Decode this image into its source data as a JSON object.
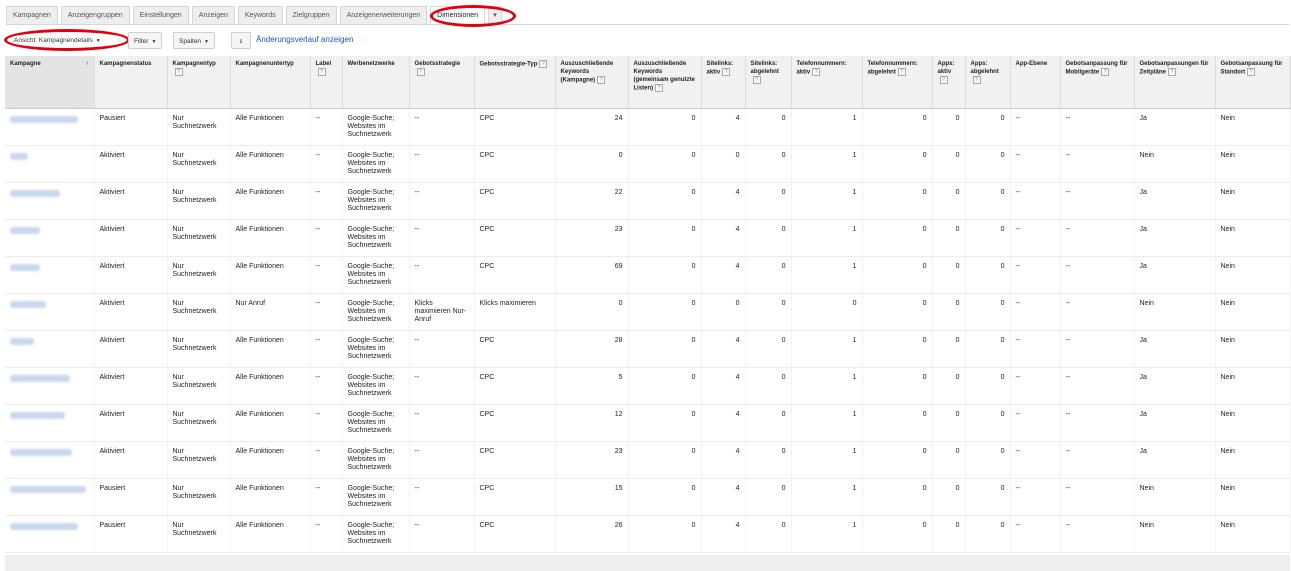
{
  "tabs": [
    {
      "label": "Kampagnen",
      "active": false
    },
    {
      "label": "Anzeigengruppen",
      "active": false
    },
    {
      "label": "Einstellungen",
      "active": false
    },
    {
      "label": "Anzeigen",
      "active": false
    },
    {
      "label": "Keywords",
      "active": false
    },
    {
      "label": "Zielgruppen",
      "active": false
    },
    {
      "label": "Anzeigenerweiterungen",
      "active": false
    },
    {
      "label": "Dimensionen",
      "active": true
    }
  ],
  "tab_more_glyph": "▾",
  "toolbar": {
    "view_label": "Ansicht: Kampagnendetails",
    "filter_label": "Filter",
    "columns_label": "Spalten",
    "download_icon": "download-icon",
    "history_link": "Änderungsverlauf anzeigen"
  },
  "accent_colors": {
    "link": "#1a55c0",
    "highlight_ring": "#e0000f",
    "header_bg": "#f1f1f1"
  },
  "table": {
    "headers": [
      {
        "label": "Kampagne",
        "help": false
      },
      {
        "label": "Kampagnenstatus",
        "help": false
      },
      {
        "label": "Kampagnentyp",
        "help": true
      },
      {
        "label": "Kampagnenuntertyp",
        "help": false
      },
      {
        "label": "Label",
        "help": true
      },
      {
        "label": "Werbenetzwerke",
        "help": false
      },
      {
        "label": "Gebotsstrategie",
        "help": true
      },
      {
        "label": "Gebotsstrategie-Typ",
        "help": true
      },
      {
        "label": "Auszuschließende Keywords (Kampagne)",
        "help": true
      },
      {
        "label": "Auszuschließende Keywords (gemeinsam genutzte Listen)",
        "help": true
      },
      {
        "label": "Sitelinks: aktiv",
        "help": true
      },
      {
        "label": "Sitelinks: abgelehnt",
        "help": true
      },
      {
        "label": "Telefonnummern: aktiv",
        "help": true
      },
      {
        "label": "Telefonnummern: abgelehnt",
        "help": true
      },
      {
        "label": "Apps: aktiv",
        "help": true
      },
      {
        "label": "Apps: abgelehnt",
        "help": true
      },
      {
        "label": "App-Ebene",
        "help": false
      },
      {
        "label": "Gebotsanpassung für Mobilgeräte",
        "help": true
      },
      {
        "label": "Gebotsanpassungen für Zeitpläne",
        "help": true
      },
      {
        "label": "Gebotsanpassung für Standort",
        "help": true
      }
    ],
    "sort_glyph": "↑",
    "help_glyph": "?",
    "rows": [
      [
        "",
        "Pausiert",
        "Nur Suchnetzwerk",
        "Alle Funktionen",
        "--",
        "Google-Suche; Websites im Suchnetzwerk",
        "--",
        "CPC",
        "24",
        "0",
        "4",
        "0",
        "1",
        "0",
        "0",
        "0",
        "--",
        "--",
        "Ja",
        "Nein"
      ],
      [
        "",
        "Aktiviert",
        "Nur Suchnetzwerk",
        "Alle Funktionen",
        "--",
        "Google-Suche; Websites im Suchnetzwerk",
        "--",
        "CPC",
        "0",
        "0",
        "0",
        "0",
        "1",
        "0",
        "0",
        "0",
        "--",
        "--",
        "Nein",
        "Nein"
      ],
      [
        "",
        "Aktiviert",
        "Nur Suchnetzwerk",
        "Alle Funktionen",
        "--",
        "Google-Suche; Websites im Suchnetzwerk",
        "--",
        "CPC",
        "22",
        "0",
        "4",
        "0",
        "1",
        "0",
        "0",
        "0",
        "--",
        "--",
        "Ja",
        "Nein"
      ],
      [
        "",
        "Aktiviert",
        "Nur Suchnetzwerk",
        "Alle Funktionen",
        "--",
        "Google-Suche; Websites im Suchnetzwerk",
        "--",
        "CPC",
        "23",
        "0",
        "4",
        "0",
        "1",
        "0",
        "0",
        "0",
        "--",
        "--",
        "Ja",
        "Nein"
      ],
      [
        "",
        "Aktiviert",
        "Nur Suchnetzwerk",
        "Alle Funktionen",
        "--",
        "Google-Suche; Websites im Suchnetzwerk",
        "--",
        "CPC",
        "69",
        "0",
        "4",
        "0",
        "1",
        "0",
        "0",
        "0",
        "--",
        "--",
        "Ja",
        "Nein"
      ],
      [
        "",
        "Aktiviert",
        "Nur Suchnetzwerk",
        "Nur Anruf",
        "--",
        "Google-Suche; Websites im Suchnetzwerk",
        "Klicks maximieren Nur-Anruf",
        "Klicks maximieren",
        "0",
        "0",
        "0",
        "0",
        "0",
        "0",
        "0",
        "0",
        "--",
        "--",
        "Nein",
        "Nein"
      ],
      [
        "",
        "Aktiviert",
        "Nur Suchnetzwerk",
        "Alle Funktionen",
        "--",
        "Google-Suche; Websites im Suchnetzwerk",
        "--",
        "CPC",
        "28",
        "0",
        "4",
        "0",
        "1",
        "0",
        "0",
        "0",
        "--",
        "--",
        "Ja",
        "Nein"
      ],
      [
        "",
        "Aktiviert",
        "Nur Suchnetzwerk",
        "Alle Funktionen",
        "--",
        "Google-Suche; Websites im Suchnetzwerk",
        "--",
        "CPC",
        "5",
        "0",
        "4",
        "0",
        "1",
        "0",
        "0",
        "0",
        "--",
        "--",
        "Ja",
        "Nein"
      ],
      [
        "",
        "Aktiviert",
        "Nur Suchnetzwerk",
        "Alle Funktionen",
        "--",
        "Google-Suche; Websites im Suchnetzwerk",
        "--",
        "CPC",
        "12",
        "0",
        "4",
        "0",
        "1",
        "0",
        "0",
        "0",
        "--",
        "--",
        "Ja",
        "Nein"
      ],
      [
        "",
        "Aktiviert",
        "Nur Suchnetzwerk",
        "Alle Funktionen",
        "--",
        "Google-Suche; Websites im Suchnetzwerk",
        "--",
        "CPC",
        "23",
        "0",
        "4",
        "0",
        "1",
        "0",
        "0",
        "0",
        "--",
        "--",
        "Ja",
        "Nein"
      ],
      [
        "",
        "Pausiert",
        "Nur Suchnetzwerk",
        "Alle Funktionen",
        "--",
        "Google-Suche; Websites im Suchnetzwerk",
        "--",
        "CPC",
        "15",
        "0",
        "4",
        "0",
        "1",
        "0",
        "0",
        "0",
        "--",
        "--",
        "Nein",
        "Nein"
      ],
      [
        "",
        "Pausiert",
        "Nur Suchnetzwerk",
        "Alle Funktionen",
        "--",
        "Google-Suche; Websites im Suchnetzwerk",
        "--",
        "CPC",
        "26",
        "0",
        "4",
        "0",
        "1",
        "0",
        "0",
        "0",
        "--",
        "--",
        "Nein",
        "Nein"
      ]
    ]
  }
}
